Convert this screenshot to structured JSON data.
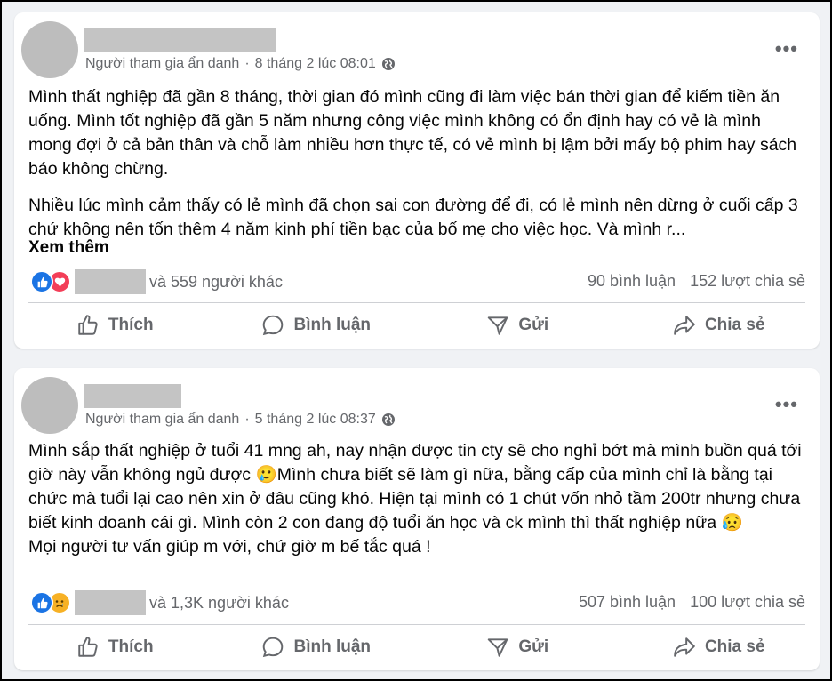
{
  "posts": [
    {
      "author_meta": "Người tham gia ẩn danh",
      "dot": "·",
      "date": "8 tháng 2 lúc 08:01",
      "paragraphs": [
        "Mình thất nghiệp đã gần 8 tháng, thời gian đó mình cũng đi làm việc bán thời gian để kiếm tiền ăn uống. Mình tốt nghiệp đã gần 5 năm nhưng công việc mình không có ổn định hay có vẻ là mình mong đợi ở cả bản thân và chỗ làm nhiều hơn thực tế, có vẻ mình bị lậm bởi mấy bộ phim hay sách báo không chừng.",
        "Nhiều lúc mình cảm thấy có lẻ mình đã chọn sai con đường để đi, có lẻ mình nên dừng ở cuối cấp 3 chứ không nên tốn thêm 4 năm kinh phí tiền bạc của bố mẹ cho việc học. Và mình r..."
      ],
      "see_more": "Xem thêm",
      "reactions_text": "và 559 người khác",
      "comments": "90 bình luận",
      "shares": "152 lượt chia sẻ",
      "reaction_icons": [
        "like-icon",
        "love-icon"
      ]
    },
    {
      "author_meta": "Người tham gia ẩn danh",
      "dot": "·",
      "date": "5 tháng 2 lúc 08:37",
      "paragraphs": [
        "Mình sắp thất nghiệp ở tuổi 41 mng ah, nay nhận được tin cty sẽ cho nghỉ bớt mà mình buồn quá tới giờ này vẫn không ngủ được 🥲Mình chưa biết sẽ làm gì nữa, bằng cấp của mình chỉ là bằng tại chức mà tuổi lại cao nên xin ở đâu cũng khó. Hiện tại mình có 1 chút vốn nhỏ tầm 200tr nhưng chưa biết kinh doanh cái gì. Mình còn 2 con đang độ tuổi ăn học và ck mình thì thất nghiệp nữa 😥",
        "Mọi người tư vấn giúp m với, chứ giờ m bế tắc quá !"
      ],
      "reactions_text": "và 1,3K người khác",
      "comments": "507 bình luận",
      "shares": "100 lượt chia sẻ",
      "reaction_icons": [
        "like-icon",
        "sad-icon"
      ]
    }
  ],
  "actions": {
    "like": "Thích",
    "comment": "Bình luận",
    "send": "Gửi",
    "share": "Chia sẻ"
  },
  "colors": {
    "background": "#f0f2f5",
    "text": "#050505",
    "secondary": "#65676b",
    "like_blue": "#1b74e4",
    "love_red": "#f33e58"
  }
}
